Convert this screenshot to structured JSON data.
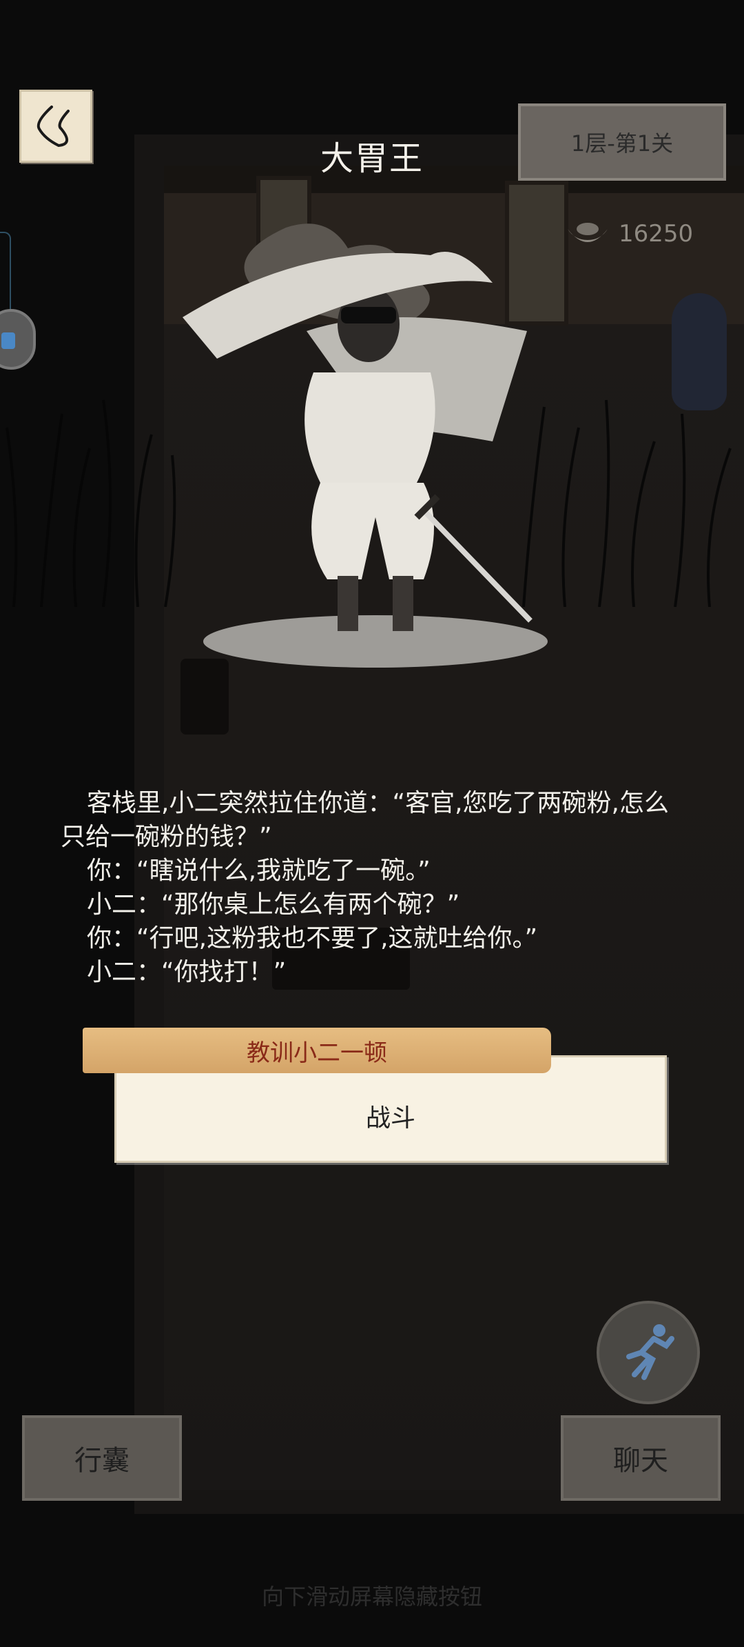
{
  "header": {
    "title": "大胃王",
    "level": "1层-第1关"
  },
  "currency": {
    "icon": "silver-ingot-icon",
    "amount": "16250"
  },
  "story": {
    "lines": [
      "　客栈里,小二突然拉住你道：“客官,您吃了两碗粉,怎么",
      "只给一碗粉的钱？”",
      "　你：“瞎说什么,我就吃了一碗。”",
      "　小二：“那你桌上怎么有两个碗？”",
      "　你：“行吧,这粉我也不要了,这就吐给你。”",
      "　小二：“你找打！”"
    ]
  },
  "choice": {
    "title": "教训小二一顿",
    "action": "战斗"
  },
  "buttons": {
    "bag": "行囊",
    "chat": "聊天"
  },
  "hint": "向下滑动屏幕隐藏按钮",
  "colors": {
    "background": "#141414",
    "choice_tab": "#d9aa6e",
    "choice_text": "#8a2a18",
    "card": "#f8f2e3"
  }
}
